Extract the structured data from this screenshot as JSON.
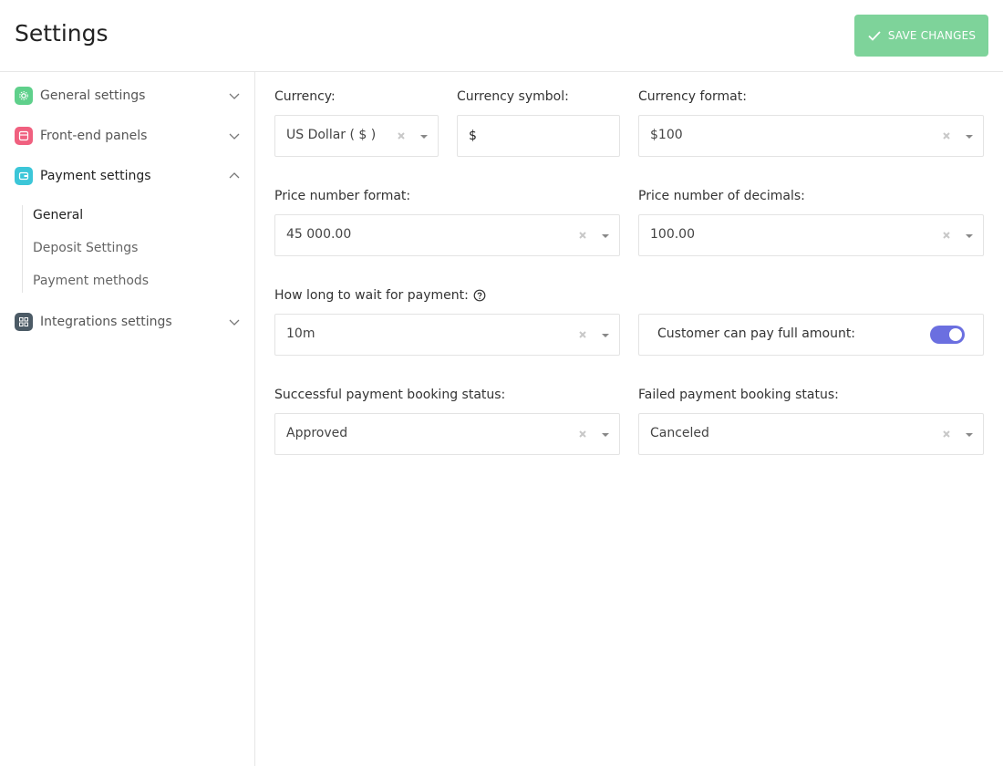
{
  "header": {
    "title": "Settings",
    "save_label": "SAVE CHANGES"
  },
  "sidebar": {
    "items": [
      {
        "label": "General settings",
        "icon": "gear-icon",
        "color": "#5fd08b"
      },
      {
        "label": "Front-end panels",
        "icon": "panel-icon",
        "color": "#f0607f"
      },
      {
        "label": "Payment settings",
        "icon": "wallet-icon",
        "color": "#3cc6d8"
      },
      {
        "label": "Integrations settings",
        "icon": "grid-icon",
        "color": "#4c5b66"
      }
    ],
    "sub_items": [
      {
        "label": "General"
      },
      {
        "label": "Deposit Settings"
      },
      {
        "label": "Payment methods"
      }
    ]
  },
  "form": {
    "currency": {
      "label": "Currency:",
      "value": "US Dollar ( $ )"
    },
    "currency_symbol": {
      "label": "Currency symbol:",
      "value": "$"
    },
    "currency_format": {
      "label": "Currency format:",
      "value": "$100"
    },
    "price_number_format": {
      "label": "Price number format:",
      "value": "45 000.00"
    },
    "price_decimals": {
      "label": "Price number of decimals:",
      "value": "100.00"
    },
    "wait_payment": {
      "label": "How long to wait for payment:",
      "value": "10m"
    },
    "full_amount": {
      "label": "Customer can pay full amount:",
      "enabled": true
    },
    "success_status": {
      "label": "Successful payment booking status:",
      "value": "Approved"
    },
    "failed_status": {
      "label": "Failed payment booking status:",
      "value": "Canceled"
    }
  },
  "colors": {
    "accent": "#7ed39a",
    "toggle": "#6b6fe0"
  }
}
